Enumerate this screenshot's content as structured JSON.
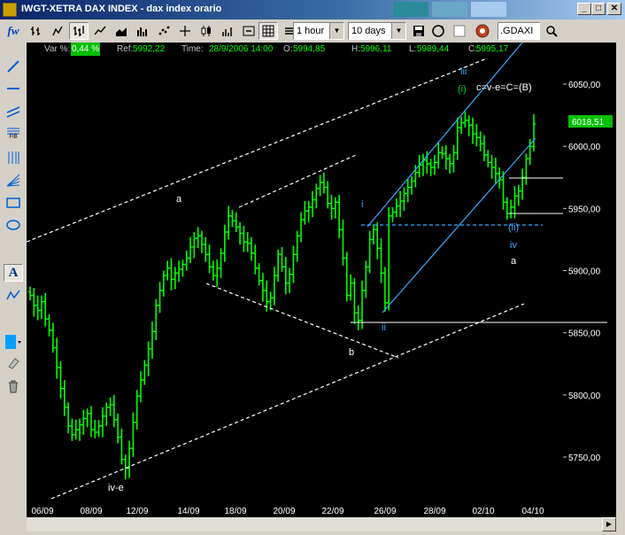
{
  "window": {
    "title": "IWGT-XETRA DAX INDEX  -  dax index orario",
    "controls": {
      "minimize": "_",
      "maximize": "□",
      "close": "✕"
    }
  },
  "toolbar": {
    "logo": "fw",
    "interval": "1 hour",
    "range": "10 days",
    "symbol": ".GDAXI"
  },
  "info": {
    "var_label": "Var %:",
    "var_value": "0,44 %",
    "ref_label": "Ref:",
    "ref_value": "5992,22",
    "time_label": "Time:",
    "time_value": "28/9/2006 14:00",
    "open_label": "O:",
    "open_value": "5994,85",
    "high_label": "H:",
    "high_value": "5996,11",
    "low_label": "L:",
    "low_value": "5989,44",
    "close_label": "C:",
    "close_value": "5995,17"
  },
  "left_tools": [
    "trendline-icon",
    "horizontal-line-icon",
    "parallel-channel-icon",
    "fibonacci-icon",
    "vertical-lines-icon",
    "fan-icon",
    "rectangle-icon",
    "ellipse-icon",
    "text-icon",
    "wave-icon",
    "color-icon",
    "eraser-icon",
    "trash-icon"
  ],
  "left_tool_labels": {
    "fib": "FIB",
    "text": "A"
  },
  "colors": {
    "bars": "#00ff00",
    "channel": "#ffffff",
    "wave_channel": "#33aaff",
    "price_badge": "#00c000"
  },
  "chart_data": {
    "type": "ohlc",
    "y_axis_labels": [
      "6050,00",
      "6000,00",
      "5950,00",
      "5900,00",
      "5850,00",
      "5800,00",
      "5750,00"
    ],
    "y_axis_values": [
      6050,
      6000,
      5950,
      5900,
      5850,
      5800,
      5750
    ],
    "ylim": [
      5712,
      6065
    ],
    "x_axis_labels": [
      "06/09",
      "08/09",
      "12/09",
      "14/09",
      "18/09",
      "20/09",
      "22/09",
      "26/09",
      "28/09",
      "02/10",
      "04/10"
    ],
    "last_price": "6018,51",
    "close_series": [
      5880,
      5872,
      5868,
      5875,
      5861,
      5852,
      5838,
      5822,
      5805,
      5790,
      5775,
      5768,
      5772,
      5776,
      5781,
      5785,
      5772,
      5770,
      5775,
      5783,
      5790,
      5792,
      5780,
      5766,
      5748,
      5741,
      5757,
      5778,
      5799,
      5812,
      5824,
      5837,
      5851,
      5872,
      5884,
      5896,
      5902,
      5893,
      5898,
      5901,
      5905,
      5910,
      5919,
      5926,
      5928,
      5921,
      5913,
      5903,
      5896,
      5902,
      5914,
      5931,
      5944,
      5940,
      5935,
      5930,
      5923,
      5922,
      5914,
      5902,
      5892,
      5884,
      5875,
      5878,
      5896,
      5913,
      5903,
      5890,
      5897,
      5913,
      5928,
      5941,
      5948,
      5951,
      5957,
      5966,
      5971,
      5967,
      5954,
      5950,
      5955,
      5933,
      5910,
      5880,
      5890,
      5866,
      5860,
      5884,
      5903,
      5925,
      5933,
      5918,
      5898,
      5874,
      5944,
      5947,
      5952,
      5956,
      5962,
      5967,
      5972,
      5979,
      5985,
      5989,
      5986,
      5983,
      5987,
      5995,
      5994,
      5990,
      5986,
      5995,
      6015,
      6019,
      6021,
      6017,
      6010,
      6007,
      6002,
      5993,
      5987,
      5983,
      5978,
      5973,
      5955,
      5946,
      5951,
      5960,
      5964,
      5975,
      5990,
      6000,
      6018
    ],
    "annotations": [
      "iii",
      "(i)",
      "c=v-e=C=(B)",
      "a",
      "i",
      "ii",
      "(ii)",
      "iv",
      "a",
      "b",
      "iv-e"
    ]
  }
}
